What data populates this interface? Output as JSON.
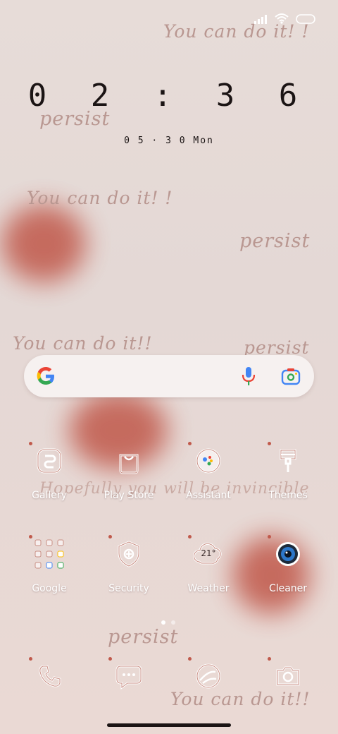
{
  "status": {
    "battery": "battery-icon",
    "wifi": "wifi-icon",
    "signal": "signal-icon"
  },
  "clock": {
    "time": "0 2 : 3 6",
    "date": "0 5 · 3 0  Mon"
  },
  "wallpaper": {
    "phrases": [
      "You can do it! !",
      "persist",
      "You can do it! !",
      "persist",
      "You can do it!!",
      "persist",
      "Hopefully you will be invincible",
      "persist",
      "You can do it!!"
    ],
    "colors": {
      "heart": "#c0584a",
      "background": "#e6dad6",
      "text": "#b99791"
    }
  },
  "search": {
    "google_icon": "google-g-icon",
    "mic_icon": "mic-icon",
    "lens_icon": "lens-icon"
  },
  "apps_row1": [
    {
      "label": "Gallery",
      "icon": "gallery-icon"
    },
    {
      "label": "Play Store",
      "icon": "play-store-icon"
    },
    {
      "label": "Assistant",
      "icon": "assistant-icon"
    },
    {
      "label": "Themes",
      "icon": "themes-icon"
    }
  ],
  "apps_row2": [
    {
      "label": "Google",
      "icon": "google-folder-icon"
    },
    {
      "label": "Security",
      "icon": "security-icon"
    },
    {
      "label": "Weather",
      "icon": "weather-icon",
      "temp": "21°"
    },
    {
      "label": "Cleaner",
      "icon": "cleaner-icon"
    }
  ],
  "dock": [
    {
      "icon": "phone-icon"
    },
    {
      "icon": "messages-icon"
    },
    {
      "icon": "browser-icon"
    },
    {
      "icon": "camera-icon"
    }
  ],
  "pager": {
    "pages": 2,
    "current": 1
  }
}
